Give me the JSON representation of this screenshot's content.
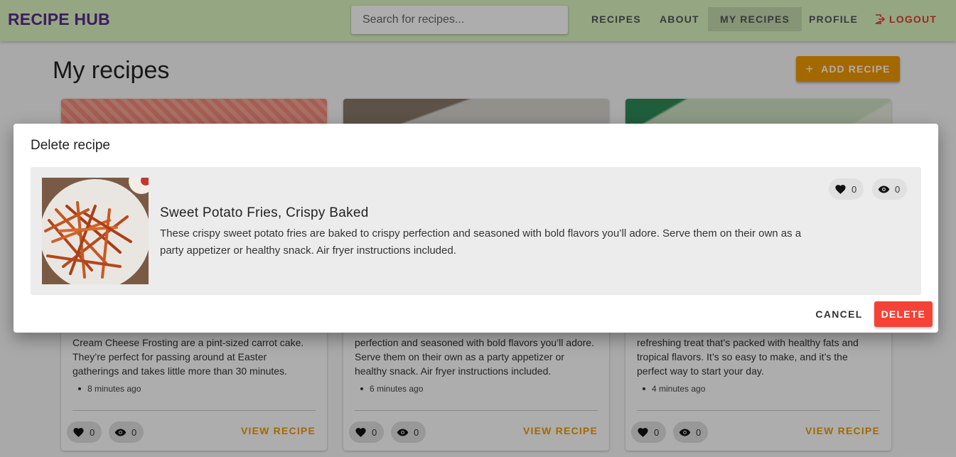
{
  "navbar": {
    "brand": "RECIPE HUB",
    "search_placeholder": "Search for recipes...",
    "items": [
      {
        "label": "RECIPES"
      },
      {
        "label": "ABOUT"
      },
      {
        "label": "MY RECIPES"
      },
      {
        "label": "PROFILE"
      }
    ],
    "logout_label": "LOGOUT"
  },
  "page": {
    "title": "My recipes",
    "add_button_label": "ADD RECIPE",
    "view_label": "VIEW RECIPE"
  },
  "cards": [
    {
      "description": "Cream Cheese Frosting are a pint-sized carrot cake. They’re perfect for passing around at Easter gatherings and takes little more than 30 minutes.",
      "time": "8 minutes ago",
      "likes": "0",
      "views": "0"
    },
    {
      "description": "perfection and seasoned with bold flavors you’ll adore. Serve them on their own as a party appetizer or healthy snack. Air fryer instructions included.",
      "time": "6 minutes ago",
      "likes": "0",
      "views": "0"
    },
    {
      "description": "refreshing treat that’s packed with healthy fats and tropical flavors. It’s so easy to make, and it’s the perfect way to start your day.",
      "time": "4 minutes ago",
      "likes": "0",
      "views": "0"
    }
  ],
  "dialog": {
    "title": "Delete recipe",
    "recipe_name": "Sweet Potato Fries, Crispy Baked",
    "recipe_description": "These crispy sweet potato fries are baked to crispy perfection and seasoned with bold flavors you’ll adore. Serve them on their own as a party appetizer or healthy snack. Air fryer instructions included.",
    "likes": "0",
    "views": "0",
    "cancel_label": "CANCEL",
    "delete_label": "DELETE"
  },
  "colors": {
    "navbar": "#dcf5c2",
    "brand": "#5b2a91",
    "accent": "#f29a00",
    "danger": "#f44336"
  }
}
